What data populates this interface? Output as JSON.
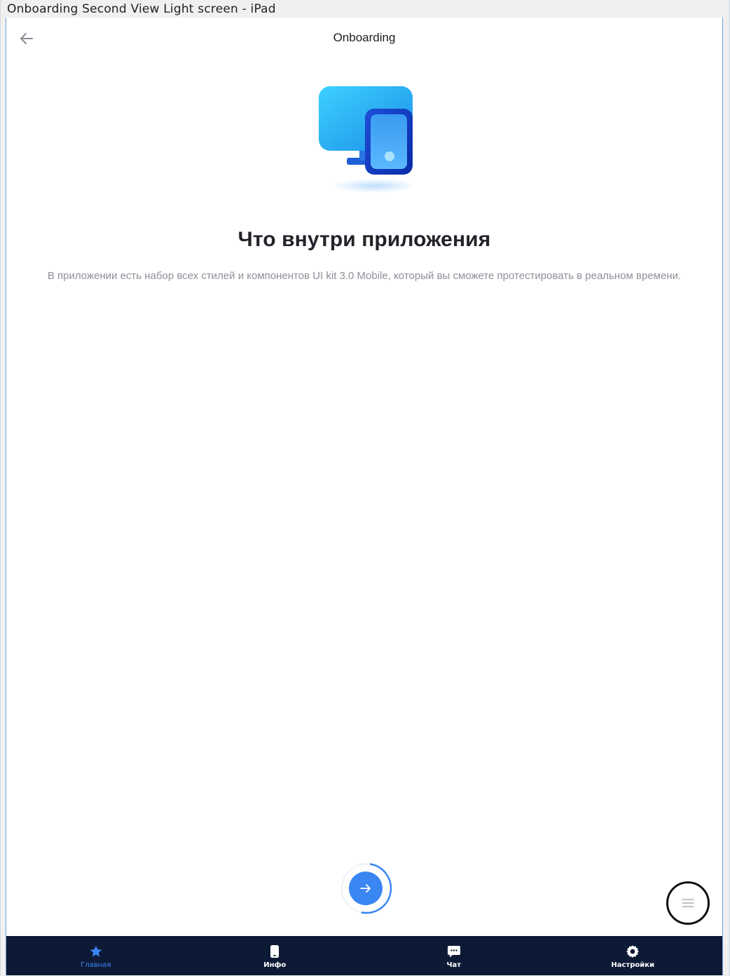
{
  "window": {
    "caption": "Onboarding Second View Light screen - iPad"
  },
  "header": {
    "title": "Onboarding",
    "back_icon": "arrow-left-icon"
  },
  "content": {
    "illustration": "monitor-phone-icon",
    "heading": "Что внутри приложения",
    "description": "В приложении есть набор всех стилей и компонентов UI kit 3.0 Mobile, который вы сможете протестировать в реальном времени."
  },
  "next_button": {
    "icon": "arrow-right-icon",
    "progress": 0.5
  },
  "menu_button": {
    "icon": "menu-icon"
  },
  "tabbar": {
    "colors": {
      "background": "#0d1a36",
      "active": "#3a86f2",
      "inactive": "#ffffff"
    },
    "items": [
      {
        "label": "Главная",
        "icon": "star-icon",
        "active": true
      },
      {
        "label": "Инфо",
        "icon": "phone-icon",
        "active": false
      },
      {
        "label": "Чат",
        "icon": "chat-icon",
        "active": false
      },
      {
        "label": "Настройки",
        "icon": "gear-icon",
        "active": false
      }
    ]
  },
  "colors": {
    "accent": "#3a86f2",
    "heading": "#22232a",
    "description": "#8c9098"
  }
}
